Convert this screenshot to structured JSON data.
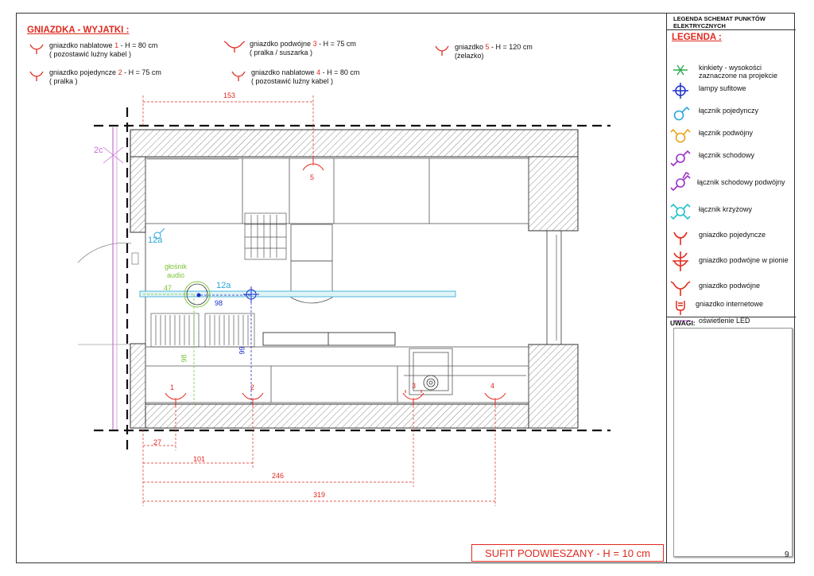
{
  "sockets_title": "GNIAZDKA - WYJATKI :",
  "exceptions": [
    {
      "pre": "gniazdko nablatowe ",
      "num": "1",
      "post": " - H = 80 cm",
      "sub": "( pozostawić luźny kabel )"
    },
    {
      "pre": "gniazdko pojedyncze ",
      "num": "2",
      "post": " - H = 75 cm",
      "sub": "( pralka )"
    },
    {
      "pre": "gniazdko podwójne ",
      "num": "3",
      "post": " - H = 75 cm",
      "sub": "( pralka / suszarka )"
    },
    {
      "pre": "gniazdko nablatowe ",
      "num": "4",
      "post": " - H = 80 cm",
      "sub": "( pozostawić luźny kabel )"
    },
    {
      "pre": "gniazdko ",
      "num": "5",
      "post": " - H = 120 cm",
      "sub": "(żelazko)"
    }
  ],
  "legend_header": "LEGENDA SCHEMAT PUNKTÓW ELEKTRYCZNYCH",
  "legend_title": "LEGENDA :",
  "legend_items": [
    {
      "label": "kinkiety - wysokości zaznaczone na projekcie",
      "icon": "wall-lamp-icon",
      "color": "#2fa84f"
    },
    {
      "label": "lampy sufitowe",
      "icon": "ceiling-lamp-icon",
      "color": "#1d2fc9"
    },
    {
      "label": "łącznik pojedynczy",
      "icon": "single-switch-icon",
      "color": "#2aa6d9"
    },
    {
      "label": "łącznik podwójny",
      "icon": "double-switch-icon",
      "color": "#e8a317"
    },
    {
      "label": "łącznik schodowy",
      "icon": "stair-switch-icon",
      "color": "#9b32c9"
    },
    {
      "label": "łącznik schodowy podwójny",
      "icon": "double-stair-switch-icon",
      "color": "#9b32c9"
    },
    {
      "label": "łącznik krzyżowy",
      "icon": "cross-switch-icon",
      "color": "#22c3c9"
    },
    {
      "label": "gniazdko pojedyncze",
      "icon": "single-socket-icon",
      "color": "#e02a1f"
    },
    {
      "label": "gniazdko podwójne w pionie",
      "icon": "vertical-double-socket-icon",
      "color": "#e02a1f"
    },
    {
      "label": "gniazdko podwójne",
      "icon": "double-socket-icon",
      "color": "#e02a1f"
    },
    {
      "label": "gniazdko internetowe",
      "icon": "network-socket-icon",
      "color": "#e02a1f"
    },
    {
      "label": "oświetlenie LED",
      "icon": "led-line-icon",
      "color": "#c86fd6"
    }
  ],
  "notes_label": "UWAGI:",
  "plan": {
    "dim_top": "153",
    "dims_bottom": [
      "27",
      "101",
      "246",
      "319"
    ],
    "socket_numbers": [
      "1",
      "2",
      "3",
      "4",
      "5"
    ],
    "speaker_label": "głośnik audio",
    "dim_speaker": "47",
    "switch_label": "12a",
    "switch_label_2": "12a",
    "dim_98": "98",
    "dim_98_v": "98",
    "dim_99": "99",
    "wall_label": "2c"
  },
  "ceiling_note": "SUFIT PODWIESZANY - H = 10 cm",
  "page_number": "9"
}
